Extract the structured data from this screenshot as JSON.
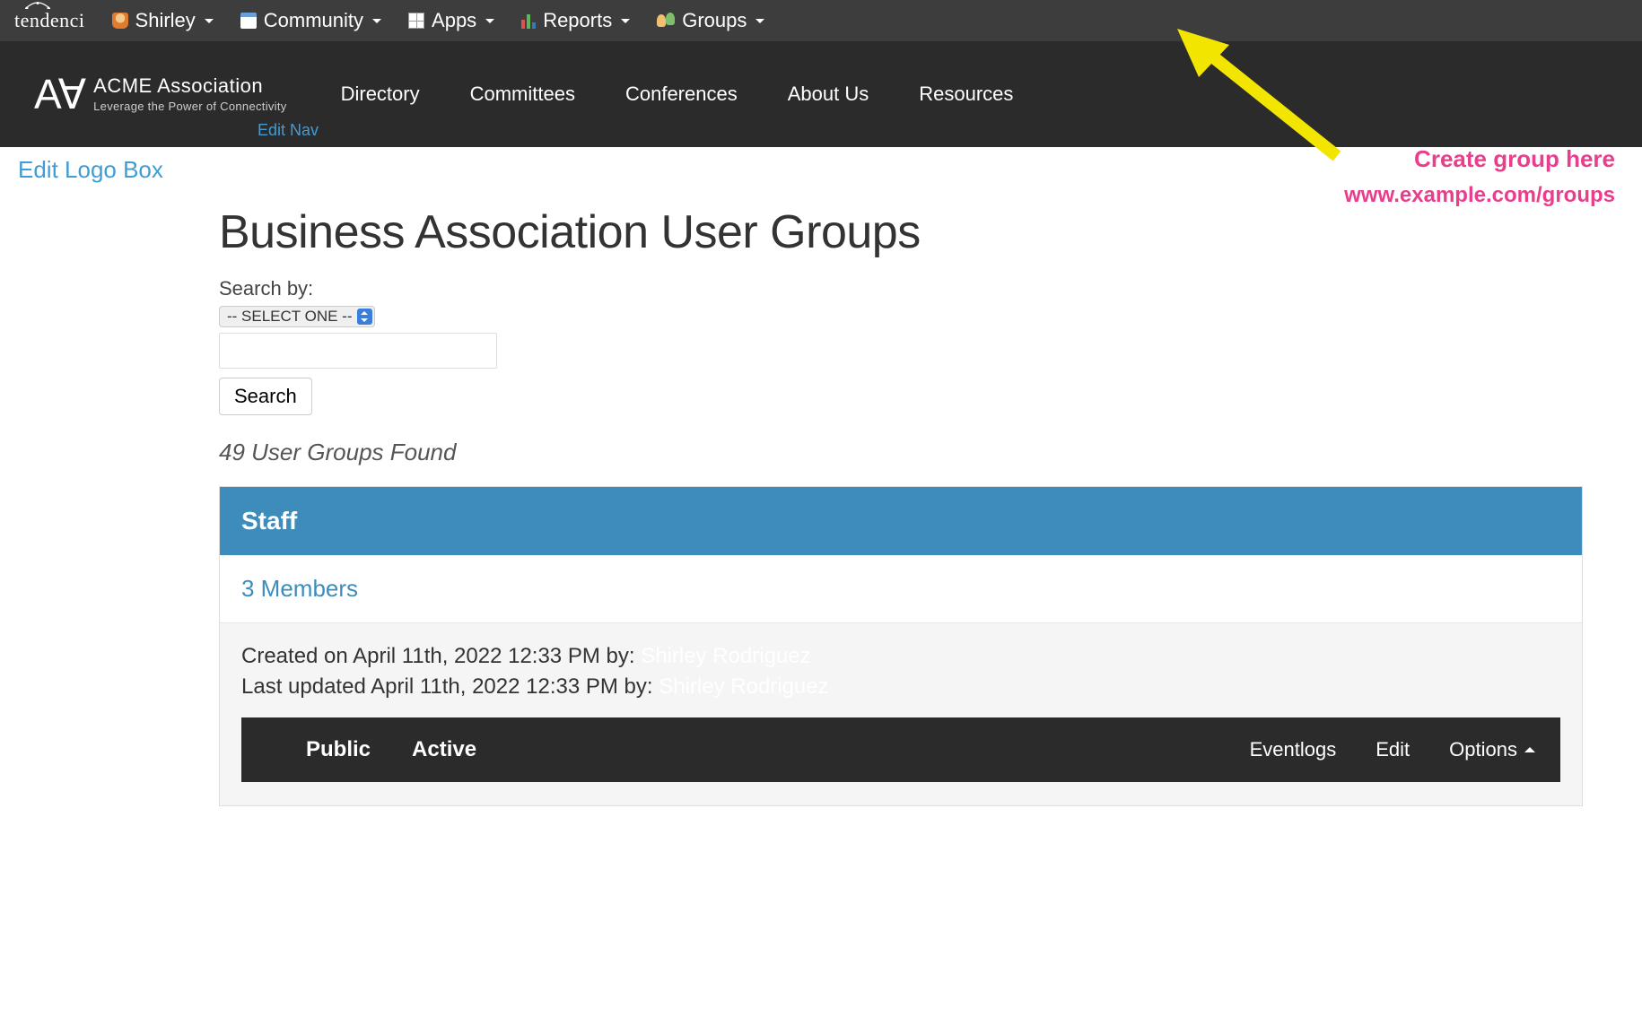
{
  "admin": {
    "brand": "tendenci",
    "items": [
      {
        "label": "Shirley",
        "icon": "user-icon"
      },
      {
        "label": "Community",
        "icon": "window-icon"
      },
      {
        "label": "Apps",
        "icon": "grid-icon"
      },
      {
        "label": "Reports",
        "icon": "bars-icon"
      },
      {
        "label": "Groups",
        "icon": "group-icon"
      }
    ]
  },
  "site": {
    "brand_mark": "A∀",
    "brand_name": "ACME Association",
    "brand_tag": "Leverage the Power of Connectivity",
    "nav": [
      "Directory",
      "Committees",
      "Conferences",
      "About Us",
      "Resources"
    ],
    "edit_nav": "Edit Nav",
    "edit_logo_box": "Edit Logo Box"
  },
  "annotation": {
    "label1": "Create group here",
    "label2": "www.example.com/groups"
  },
  "page": {
    "title": "Business Association User Groups",
    "search_label": "Search by:",
    "select_placeholder": "-- SELECT ONE --",
    "search_button": "Search",
    "found_text": "49 User Groups Found"
  },
  "group": {
    "name": "Staff",
    "members_link": "3 Members",
    "created_prefix": "Created on ",
    "created_date": "April 11th, 2022 12:33 PM",
    "created_by_label": " by: ",
    "created_by": "Shirley Rodriguez",
    "updated_prefix": "Last updated ",
    "updated_date": "April 11th, 2022 12:33 PM",
    "updated_by_label": " by: ",
    "updated_by": "Shirley Rodriguez",
    "status_public": "Public",
    "status_active": "Active",
    "actions": {
      "eventlogs": "Eventlogs",
      "edit": "Edit",
      "options": "Options"
    }
  }
}
